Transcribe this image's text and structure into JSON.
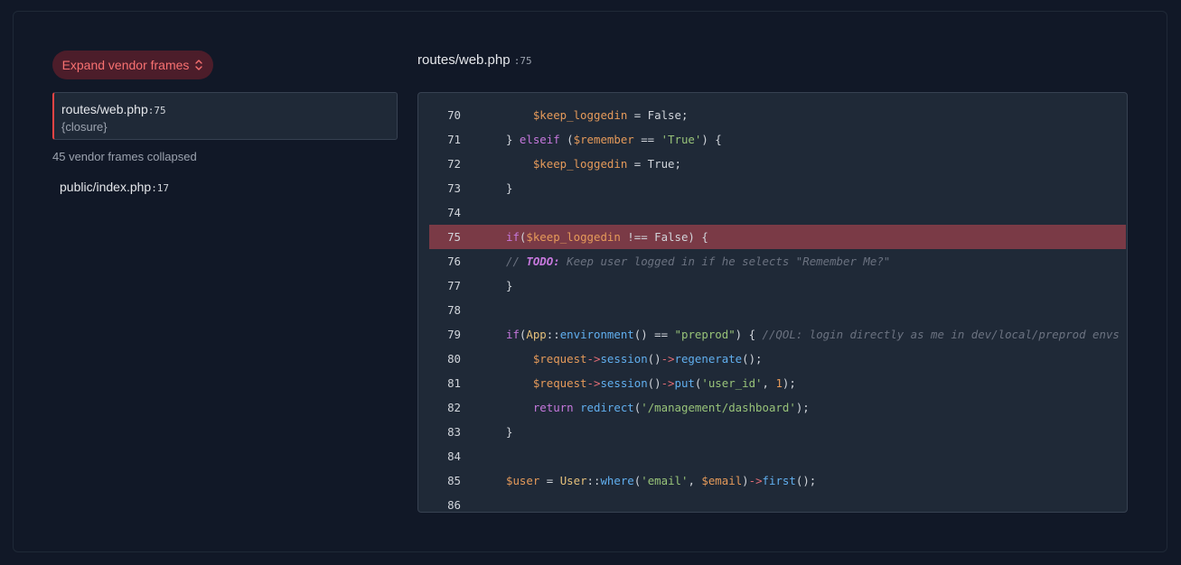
{
  "sidebar": {
    "expand_button_label": "Expand vendor frames",
    "selected_frame": {
      "file": "routes/web.php",
      "line": ":75",
      "function": "{closure}"
    },
    "collapsed_note": "45 vendor frames collapsed",
    "other_frame": {
      "file": "public/index.php",
      "line": ":17"
    }
  },
  "code": {
    "file": "routes/web.php",
    "line": ":75",
    "highlighted_line": 75,
    "lines": [
      {
        "num": "70",
        "text": "    $keep_loggedin = False;"
      },
      {
        "num": "71",
        "text": "} elseif ($remember == 'True') {"
      },
      {
        "num": "72",
        "text": "    $keep_loggedin = True;"
      },
      {
        "num": "73",
        "text": "}"
      },
      {
        "num": "74",
        "text": ""
      },
      {
        "num": "75",
        "text": "if($keep_loggedin !== False) {"
      },
      {
        "num": "76",
        "text": "// TODO: Keep user logged in if he selects \"Remember Me?\""
      },
      {
        "num": "77",
        "text": "}"
      },
      {
        "num": "78",
        "text": ""
      },
      {
        "num": "79",
        "text": "if(App::environment() == \"preprod\") { //QOL: login directly as me in dev/local/preprod envs"
      },
      {
        "num": "80",
        "text": "    $request->session()->regenerate();"
      },
      {
        "num": "81",
        "text": "    $request->session()->put('user_id', 1);"
      },
      {
        "num": "82",
        "text": "    return redirect('/management/dashboard');"
      },
      {
        "num": "83",
        "text": "}"
      },
      {
        "num": "84",
        "text": ""
      },
      {
        "num": "85",
        "text": "$user = User::where('email', $email)->first();"
      },
      {
        "num": "86",
        "text": ""
      }
    ]
  },
  "colors": {
    "background": "#111827",
    "highlight_line": "#7a3a46",
    "accent_red": "#ef4444",
    "button_text": "#f87171"
  }
}
